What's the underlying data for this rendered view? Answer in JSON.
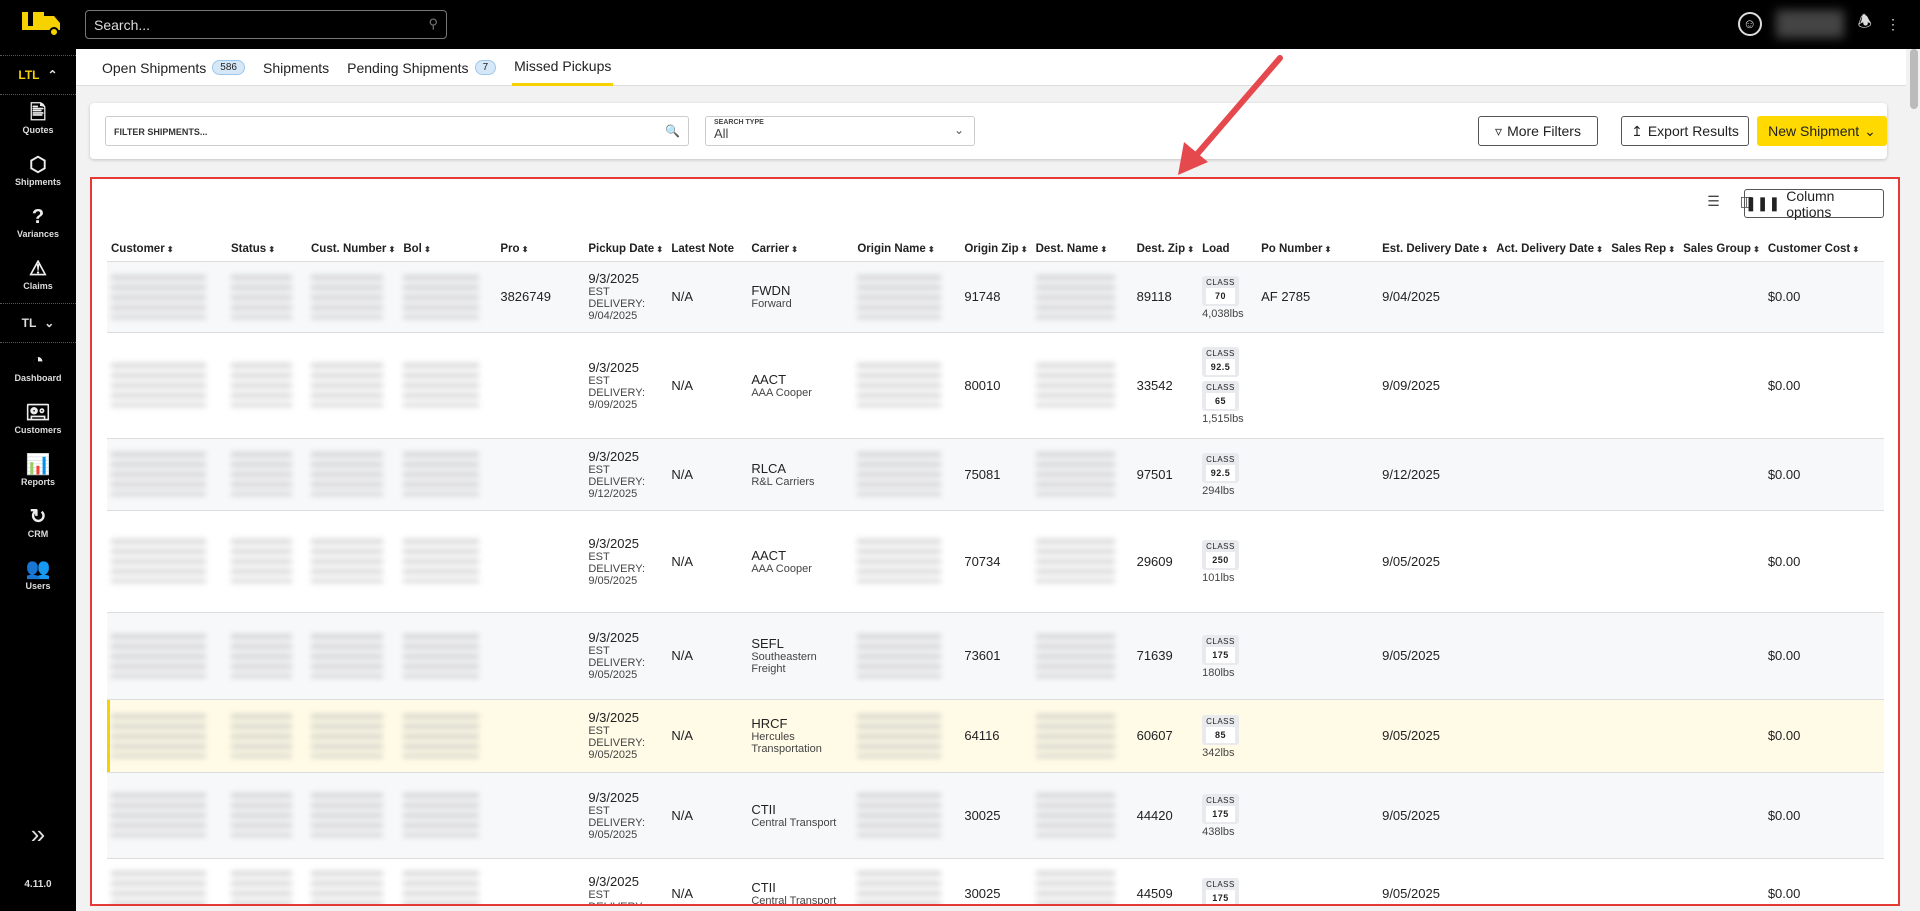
{
  "topbar": {
    "search_placeholder": "Search..."
  },
  "sidebar": {
    "sections": [
      {
        "label": "LTL",
        "items": [
          "Quotes",
          "Shipments",
          "Variances",
          "Claims"
        ]
      },
      {
        "label": "TL",
        "items": [
          "Dashboard",
          "Customers",
          "Reports",
          "CRM",
          "Users"
        ]
      }
    ],
    "version": "4.11.0"
  },
  "tabs": [
    {
      "label": "Open Shipments",
      "badge": "586"
    },
    {
      "label": "Shipments"
    },
    {
      "label": "Pending Shipments",
      "badge": "7"
    },
    {
      "label": "Missed Pickups",
      "active": true
    }
  ],
  "filters": {
    "filter_placeholder": "FILTER SHIPMENTS...",
    "search_type_label": "SEARCH TYPE",
    "search_type_value": "All",
    "more_filters": "More Filters",
    "export": "Export Results",
    "new_shipment": "New Shipment"
  },
  "table": {
    "column_options": "Column options",
    "headers": [
      "Customer",
      "Status",
      "Cust. Number",
      "Bol",
      "Pro",
      "Pickup Date",
      "Latest Note",
      "Carrier",
      "Origin Name",
      "Origin Zip",
      "Dest. Name",
      "Dest. Zip",
      "Load",
      "Po Number",
      "Est. Delivery Date",
      "Act. Delivery Date",
      "Sales Rep",
      "Sales Group",
      "Customer Cost"
    ],
    "rows": [
      {
        "pro": "3826749",
        "pickup": "9/3/2025",
        "est": "EST DELIVERY: 9/04/2025",
        "note": "N/A",
        "carrier_code": "FWDN",
        "carrier_name": "Forward",
        "origin_zip": "91748",
        "dest_zip": "89118",
        "classes": [
          "70"
        ],
        "weight": "4,038lbs",
        "po": "AF 2785",
        "est_delivery": "9/04/2025",
        "cost": "$0.00"
      },
      {
        "pro": "",
        "pickup": "9/3/2025",
        "est": "EST DELIVERY: 9/09/2025",
        "note": "N/A",
        "carrier_code": "AACT",
        "carrier_name": "AAA Cooper",
        "origin_zip": "80010",
        "dest_zip": "33542",
        "classes": [
          "92.5",
          "65"
        ],
        "weight": "1,515lbs",
        "po": "",
        "est_delivery": "9/09/2025",
        "cost": "$0.00"
      },
      {
        "pro": "",
        "pickup": "9/3/2025",
        "est": "EST DELIVERY: 9/12/2025",
        "note": "N/A",
        "carrier_code": "RLCA",
        "carrier_name": "R&L Carriers",
        "origin_zip": "75081",
        "dest_zip": "97501",
        "classes": [
          "92.5"
        ],
        "weight": "294lbs",
        "po": "",
        "est_delivery": "9/12/2025",
        "cost": "$0.00"
      },
      {
        "pro": "",
        "pickup": "9/3/2025",
        "est": "EST DELIVERY: 9/05/2025",
        "note": "N/A",
        "carrier_code": "AACT",
        "carrier_name": "AAA Cooper",
        "origin_zip": "70734",
        "dest_zip": "29609",
        "classes": [
          "250"
        ],
        "weight": "101lbs",
        "po": "",
        "est_delivery": "9/05/2025",
        "cost": "$0.00"
      },
      {
        "pro": "",
        "pickup": "9/3/2025",
        "est": "EST DELIVERY: 9/05/2025",
        "note": "N/A",
        "carrier_code": "SEFL",
        "carrier_name": "Southeastern Freight",
        "origin_zip": "73601",
        "dest_zip": "71639",
        "classes": [
          "175"
        ],
        "weight": "180lbs",
        "po": "",
        "est_delivery": "9/05/2025",
        "cost": "$0.00"
      },
      {
        "pro": "",
        "pickup": "9/3/2025",
        "est": "EST DELIVERY: 9/05/2025",
        "note": "N/A",
        "carrier_code": "HRCF",
        "carrier_name": "Hercules Transportation",
        "origin_zip": "64116",
        "dest_zip": "60607",
        "classes": [
          "85"
        ],
        "weight": "342lbs",
        "po": "",
        "est_delivery": "9/05/2025",
        "cost": "$0.00",
        "highlight": true
      },
      {
        "pro": "",
        "pickup": "9/3/2025",
        "est": "EST DELIVERY: 9/05/2025",
        "note": "N/A",
        "carrier_code": "CTII",
        "carrier_name": "Central Transport",
        "origin_zip": "30025",
        "dest_zip": "44420",
        "classes": [
          "175"
        ],
        "weight": "438lbs",
        "po": "",
        "est_delivery": "9/05/2025",
        "cost": "$0.00"
      },
      {
        "pro": "",
        "pickup": "9/3/2025",
        "est": "EST DELIVERY:",
        "note": "N/A",
        "carrier_code": "CTII",
        "carrier_name": "Central Transport",
        "origin_zip": "30025",
        "dest_zip": "44509",
        "classes": [
          "175"
        ],
        "weight": "",
        "po": "",
        "est_delivery": "9/05/2025",
        "cost": "$0.00"
      }
    ]
  },
  "colors": {
    "accent": "#ffd900",
    "highlight_border": "#e53935"
  }
}
